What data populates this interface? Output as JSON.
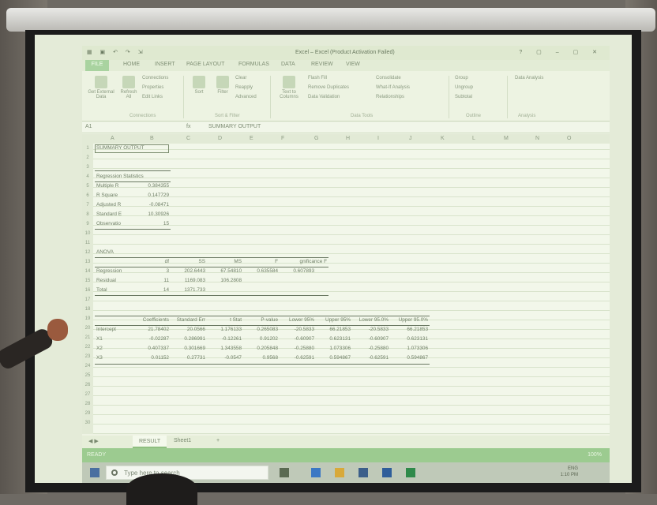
{
  "titlebar": {
    "qa": "",
    "title": "Excel – Excel (Product Activation Failed)",
    "winctl": "? ▢ – ▢ ✕"
  },
  "tabs": [
    "FILE",
    "HOME",
    "INSERT",
    "PAGE LAYOUT",
    "FORMULAS",
    "DATA",
    "REVIEW",
    "VIEW"
  ],
  "ribbon": {
    "get_external": "Get External Data",
    "refresh": "Refresh All",
    "connections": "Connections",
    "properties": "Properties",
    "edit_links": "Edit Links",
    "sort": "Sort",
    "filter": "Filter",
    "clear": "Clear",
    "reapply": "Reapply",
    "advanced": "Advanced",
    "text_to_columns": "Text to Columns",
    "flash_fill": "Flash Fill",
    "remove_dup": "Remove Duplicates",
    "data_validation": "Data Validation",
    "consolidate": "Consolidate",
    "what_if": "What-If Analysis",
    "relationships": "Relationships",
    "group": "Group",
    "ungroup": "Ungroup",
    "subtotal": "Subtotal",
    "data_analysis": "Data Analysis",
    "g_connections": "Connections",
    "g_sortfilter": "Sort & Filter",
    "g_datatools": "Data Tools",
    "g_outline": "Outline",
    "g_analysis": "Analysis"
  },
  "formulabar": {
    "name_box": "A1",
    "fx": "fx",
    "value": "SUMMARY OUTPUT"
  },
  "columns": [
    "A",
    "B",
    "C",
    "D",
    "E",
    "F",
    "G",
    "H",
    "I",
    "J",
    "K",
    "L",
    "M",
    "N",
    "O"
  ],
  "rows": [
    "1",
    "2",
    "3",
    "4",
    "5",
    "6",
    "7",
    "8",
    "9",
    "10",
    "11",
    "12",
    "13",
    "14",
    "15",
    "16",
    "17",
    "18",
    "19",
    "20",
    "21",
    "22",
    "23",
    "24",
    "25",
    "26",
    "27",
    "28",
    "29",
    "30"
  ],
  "sheet": {
    "summary_output": "SUMMARY OUTPUT",
    "reg_stats": "Regression Statistics",
    "multiple_r": "Multiple R",
    "multiple_r_v": "0.384355",
    "r_square": "R Square",
    "r_square_v": "0.147729",
    "adj_r": "Adjusted R",
    "adj_r_v": "-0.08471",
    "std_err": "Standard E",
    "std_err_v": "10.30926",
    "observ": "Observatio",
    "observ_v": "15",
    "anova": "ANOVA",
    "h_df": "df",
    "h_ss": "SS",
    "h_ms": "MS",
    "h_f": "F",
    "h_sigf": "gnificance F",
    "regression": "Regression",
    "reg_df": "3",
    "reg_ss": "202.6443",
    "reg_ms": "67.54810",
    "reg_f": "0.635584",
    "reg_sig": "0.607893",
    "residual": "Residual",
    "res_df": "11",
    "res_ss": "1169.083",
    "res_ms": "106.2808",
    "total": "Total",
    "tot_df": "14",
    "tot_ss": "1371.733",
    "h_coef": "Coefficients",
    "h_se": "Standard Err",
    "h_t": "t Stat",
    "h_p": "P-value",
    "h_l95": "Lower 95%",
    "h_u95": "Upper 95%",
    "h_l950": "Lower 95.0%",
    "h_u950": "Upper 95.0%",
    "intercept": "Intercept",
    "i1": "21.78402",
    "i2": "20.0566",
    "i3": "1.176133",
    "i4": "0.265083",
    "i5": "-20.5833",
    "i6": "66.21853",
    "i7": "-20.5833",
    "i8": "66.21853",
    "x1": "X1",
    "x1a": "-0.02287",
    "x1b": "0.286991",
    "x1c": "-0.12261",
    "x1d": "0.91202",
    "x1e": "-0.60907",
    "x1f": "0.623131",
    "x1g": "-0.60907",
    "x1h": "0.623131",
    "x2": "X2",
    "x2a": "0.407337",
    "x2b": "0.301669",
    "x2c": "1.343558",
    "x2d": "0.205848",
    "x2e": "-0.25880",
    "x2f": "1.073306",
    "x2g": "-0.25880",
    "x2h": "1.073306",
    "x3": "X3",
    "x3a": "0.01152",
    "x3b": "0.27731",
    "x3c": "-0.0547",
    "x3d": "0.9568",
    "x3e": "-0.62591",
    "x3f": "0.594867",
    "x3g": "-0.62591",
    "x3h": "0.594867"
  },
  "sheet_tabs": {
    "result": "RESULT",
    "sheet1": "Sheet1",
    "add": "+"
  },
  "status": {
    "ready": "READY",
    "zoom": "100%"
  },
  "taskbar": {
    "search": "Type here to search",
    "lang": "ENG",
    "time": "1:10 PM"
  }
}
